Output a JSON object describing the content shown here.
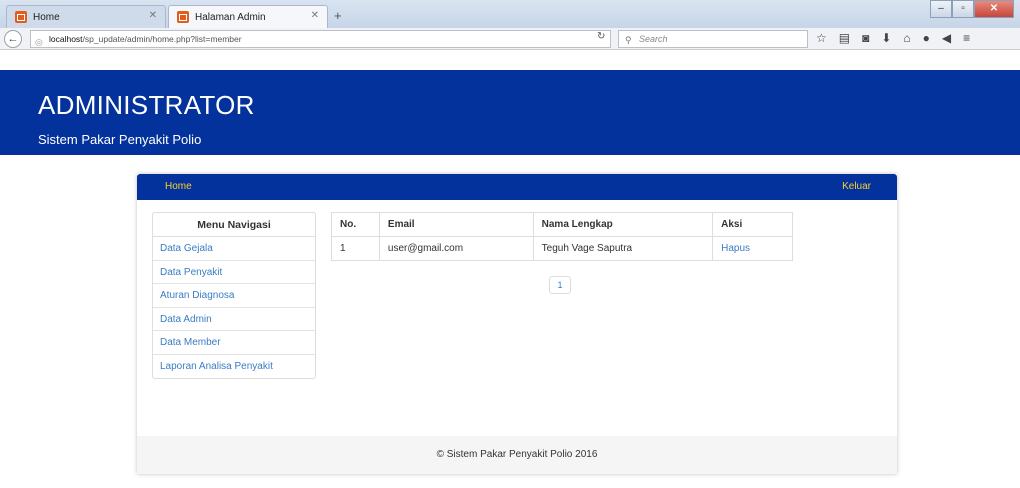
{
  "browser": {
    "tabs": [
      {
        "label": "Home"
      },
      {
        "label": "Halaman Admin"
      }
    ],
    "url_host": "localhost",
    "url_path": "/sp_update/admin/home.php?list=member",
    "search_placeholder": "Search"
  },
  "header": {
    "title": "ADMINISTRATOR",
    "subtitle": "Sistem Pakar Penyakit Polio"
  },
  "nav": {
    "home": "Home",
    "logout": "Keluar"
  },
  "sidebar": {
    "title": "Menu Navigasi",
    "items": [
      {
        "label": "Data Gejala"
      },
      {
        "label": "Data Penyakit"
      },
      {
        "label": "Aturan Diagnosa"
      },
      {
        "label": "Data Admin"
      },
      {
        "label": "Data Member"
      },
      {
        "label": "Laporan Analisa Penyakit"
      }
    ]
  },
  "table": {
    "headers": [
      "No.",
      "Email",
      "Nama Lengkap",
      "Aksi"
    ],
    "rows": [
      {
        "no": "1",
        "email": "user@gmail.com",
        "name": "Teguh Vage Saputra",
        "action": "Hapus"
      }
    ]
  },
  "pagination": {
    "current": "1"
  },
  "footer": {
    "text": "© Sistem Pakar Penyakit Polio 2016"
  },
  "colors": {
    "brand": "#03329c",
    "nav_link": "#ffcf2d",
    "link": "#3b7cc2"
  }
}
